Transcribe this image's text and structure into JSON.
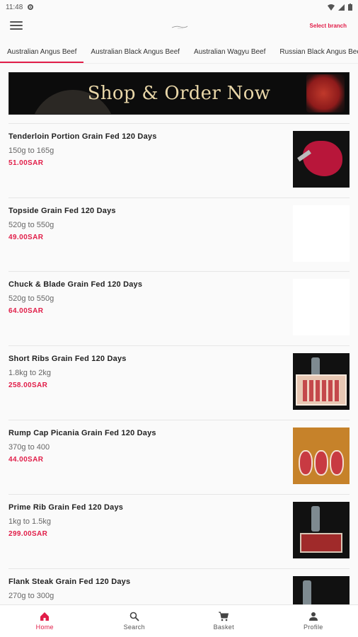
{
  "status": {
    "time": "11:48"
  },
  "header": {
    "select_branch": "Select branch"
  },
  "tabs": [
    {
      "label": "Australian Angus Beef",
      "active": true
    },
    {
      "label": "Australian Black Angus Beef",
      "active": false
    },
    {
      "label": "Australian Wagyu Beef",
      "active": false
    },
    {
      "label": "Russian Black Angus Beef",
      "active": false
    }
  ],
  "banner": {
    "text": "Shop & Order Now"
  },
  "products": [
    {
      "name": "Tenderloin Portion Grain Fed 120 Days",
      "weight": "150g to 165g",
      "price": "51.00SAR",
      "image": "tenderloin-photo"
    },
    {
      "name": "Topside Grain Fed 120 Days",
      "weight": "520g to 550g",
      "price": "49.00SAR",
      "image": "blank"
    },
    {
      "name": "Chuck & Blade Grain Fed 120 Days",
      "weight": "520g to 550g",
      "price": "64.00SAR",
      "image": "blank"
    },
    {
      "name": "Short Ribs Grain Fed 120 Days",
      "weight": "1.8kg to 2kg",
      "price": "258.00SAR",
      "image": "short-ribs-photo"
    },
    {
      "name": "Rump Cap Picania Grain Fed 120 Days",
      "weight": "370g to 400",
      "price": "44.00SAR",
      "image": "picanha-photo"
    },
    {
      "name": "Prime Rib Grain Fed 120 Days",
      "weight": "1kg to 1.5kg",
      "price": "299.00SAR",
      "image": "prime-rib-photo"
    },
    {
      "name": "Flank Steak Grain Fed 120 Days",
      "weight": "270g to 300g",
      "price": "",
      "image": "flank-photo"
    }
  ],
  "nav": {
    "home": "Home",
    "search": "Search",
    "basket": "Basket",
    "profile": "Profile"
  },
  "colors": {
    "accent": "#e11d48"
  }
}
